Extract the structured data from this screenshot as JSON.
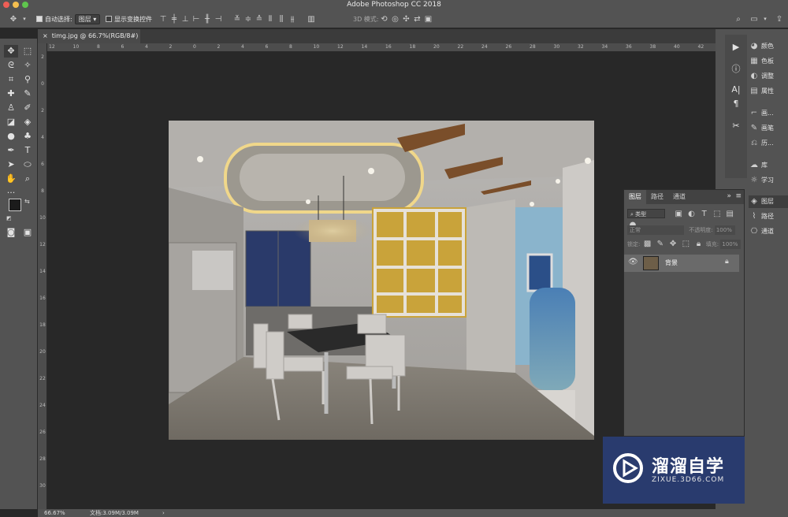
{
  "app": {
    "title": "Adobe Photoshop CC 2018"
  },
  "options_bar": {
    "auto_select_label": "自动选择:",
    "auto_select_value": "图层",
    "show_transform_label": "显示变换控件",
    "mode_3d_label": "3D 模式:"
  },
  "document": {
    "tab_title": "timg.jpg @ 66.7%(RGB/8#) *"
  },
  "rulers": {
    "horizontal": [
      "12",
      "10",
      "8",
      "6",
      "4",
      "2",
      "0",
      "2",
      "4",
      "6",
      "8",
      "10",
      "12",
      "14",
      "16",
      "18",
      "20",
      "22",
      "24",
      "26",
      "28",
      "30",
      "32",
      "34",
      "36",
      "38",
      "40",
      "42"
    ],
    "vertical": [
      "2",
      "0",
      "2",
      "4",
      "6",
      "8",
      "10",
      "12",
      "14",
      "16",
      "18",
      "20",
      "22",
      "24",
      "26",
      "28",
      "30"
    ]
  },
  "status": {
    "zoom": "66.67%",
    "doc_size": "文档:3.09M/3.09M"
  },
  "right_panels": {
    "group1": [
      "颜色",
      "色板",
      "调整",
      "属性"
    ],
    "group2": [
      "画...",
      "画笔",
      "历..."
    ],
    "group3": [
      "库",
      "学习"
    ],
    "group4": [
      "图层",
      "路径",
      "通道"
    ]
  },
  "layers_panel": {
    "tabs": [
      "图层",
      "路径",
      "通道"
    ],
    "filter_label": "类型",
    "blend_mode": "正常",
    "opacity_label": "不透明度:",
    "opacity_value": "100%",
    "lock_label": "锁定:",
    "fill_label": "填充:",
    "fill_value": "100%",
    "layer_name": "背景"
  },
  "watermark": {
    "brand": "溜溜自学",
    "url": "ZIXUE.3D66.COM"
  },
  "colors": {
    "panel_bg": "#535353",
    "canvas_bg": "#282828",
    "watermark_bg": "#293b6e"
  }
}
